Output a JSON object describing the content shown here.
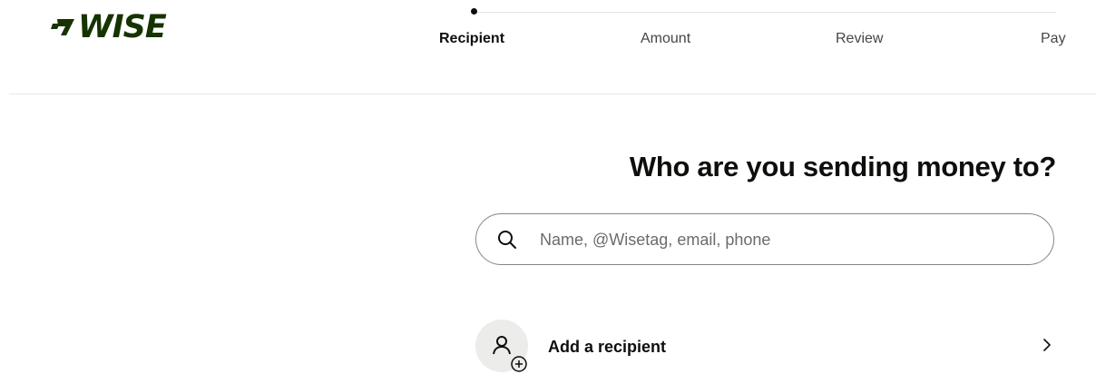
{
  "brand": {
    "name": "WISE",
    "color": "#163300",
    "icon": "wise-flag-icon"
  },
  "stepper": {
    "steps": [
      {
        "label": "Recipient",
        "active": true
      },
      {
        "label": "Amount",
        "active": false
      },
      {
        "label": "Review",
        "active": false
      },
      {
        "label": "Pay",
        "active": false
      }
    ]
  },
  "main": {
    "title": "Who are you sending money to?",
    "search": {
      "placeholder": "Name, @Wisetag, email, phone",
      "value": "",
      "icon": "search-icon"
    },
    "add_recipient": {
      "label": "Add a recipient",
      "icon": "person-add-icon",
      "chevron": "chevron-right-icon"
    }
  }
}
